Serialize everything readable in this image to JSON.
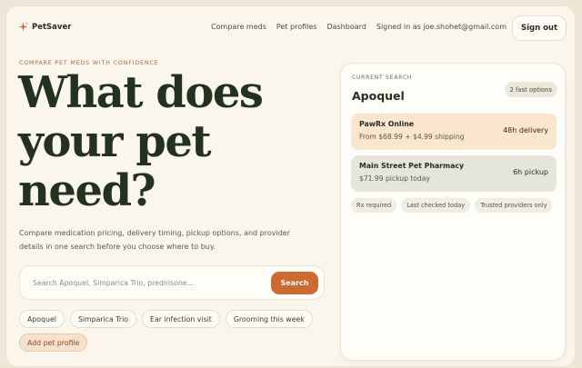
{
  "brand": {
    "name": "PetSaver",
    "logo_icon": "sparkle-icon",
    "accent": "#cc6a32"
  },
  "nav": {
    "items": [
      "Compare meds",
      "Pet profiles",
      "Dashboard"
    ],
    "signed_in": "Signed in as joe.shohet@gmail.com",
    "sign_out": "Sign out"
  },
  "hero": {
    "eyebrow": "COMPARE PET MEDS WITH CONFIDENCE",
    "headline": "What does your pet need?",
    "subtitle": "Compare medication pricing, delivery timing, pickup options, and provider details in one search before you choose where to buy."
  },
  "search": {
    "placeholder": "Search Apoquel, Simparica Trio, prednisone...",
    "value": "",
    "button": "Search"
  },
  "chips": [
    "Apoquel",
    "Simparica Trio",
    "Ear infection visit",
    "Grooming this week"
  ],
  "add_pet": "Add pet profile",
  "panel": {
    "label": "CURRENT SEARCH",
    "title": "Apoquel",
    "badge": "2 fast options",
    "options": [
      {
        "name": "PawRx Online",
        "detail": "From $68.99 + $4.99 shipping",
        "eta": "48h delivery",
        "color": "#f9e6cc"
      },
      {
        "name": "Main Street Pet Pharmacy",
        "detail": "$71.99 pickup today",
        "eta": "6h pickup",
        "color": "#e6e5d9"
      }
    ],
    "tags": [
      "Rx required",
      "Last checked today",
      "Trusted providers only"
    ]
  }
}
